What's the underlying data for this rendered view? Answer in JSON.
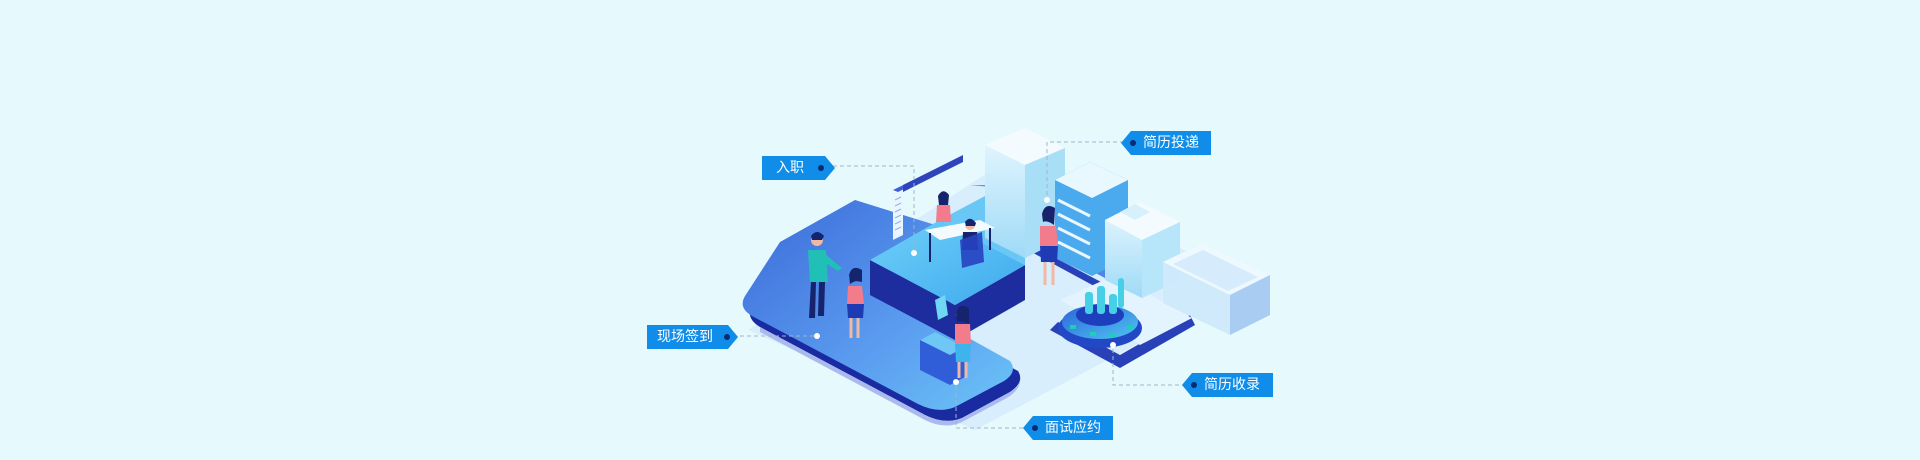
{
  "labels": {
    "onboard": "入职",
    "resume_submit": "简历投递",
    "checkin": "现场签到",
    "resume_receive": "简历收录",
    "interview": "面试应约"
  },
  "colors": {
    "background": "#e6f9fd",
    "tag": "#0f8de8",
    "tag_dot": "#0a2a74",
    "platform_top": "#4d7fe6",
    "platform_side": "#1f2f9c",
    "building": "#c9ecfb",
    "accent": "#39b7f0"
  }
}
